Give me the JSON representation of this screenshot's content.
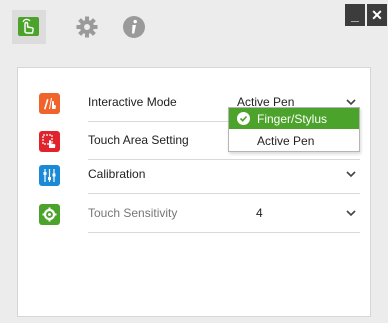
{
  "toolbar": {
    "tabs": [
      {
        "icon": "touch-screen-icon",
        "color": "#4ca32b"
      },
      {
        "icon": "gear-icon",
        "color": "#9a9a9a"
      },
      {
        "icon": "info-icon",
        "color": "#9a9a9a"
      }
    ],
    "minimize_label": "_",
    "close_label": "✕"
  },
  "settings": {
    "rows": [
      {
        "label": "Interactive Mode",
        "value": "Active Pen",
        "icon": "pen-finger-icon",
        "icon_color": "#f0642c"
      },
      {
        "label": "Touch Area Setting",
        "value": "",
        "icon": "touch-area-icon",
        "icon_color": "#e1232b"
      },
      {
        "label": "Calibration",
        "value": "",
        "icon": "calibration-icon",
        "icon_color": "#1a89d6"
      },
      {
        "label": "Touch Sensitivity",
        "value": "4",
        "icon": "sensitivity-icon",
        "icon_color": "#4ca32b"
      }
    ]
  },
  "dropdown": {
    "options": [
      {
        "label": "Finger/Stylus",
        "selected": true
      },
      {
        "label": "Active Pen",
        "selected": false
      }
    ]
  },
  "colors": {
    "accent": "#4ca32b",
    "background": "#ececec",
    "panel": "#ffffff"
  }
}
